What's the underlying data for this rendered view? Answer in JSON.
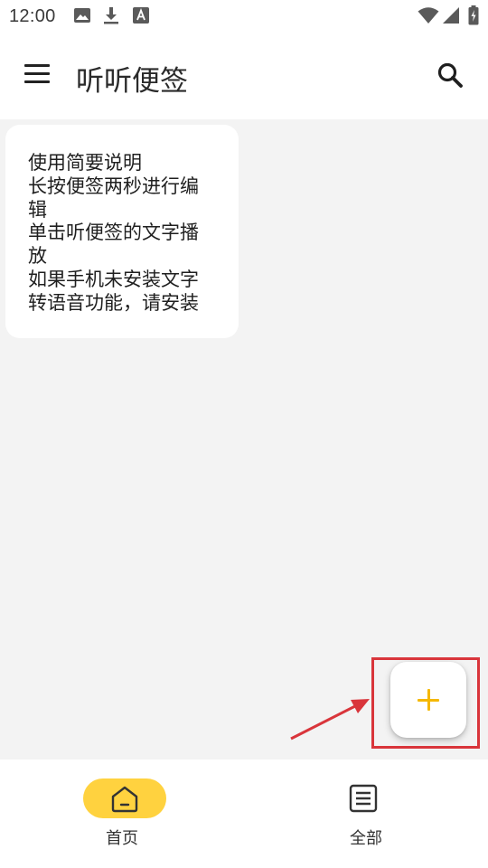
{
  "status_bar": {
    "time": "12:00",
    "left_icons": [
      "image-icon",
      "download-icon",
      "font-icon"
    ],
    "right_icons": [
      "wifi-icon",
      "signal-icon",
      "battery-icon"
    ]
  },
  "app_bar": {
    "title": "听听便签",
    "menu_icon": "menu-icon",
    "search_icon": "search-icon"
  },
  "notes": [
    {
      "text": "使用简要说明\n长按便签两秒进行编辑\n单击听便签的文字播放\n如果手机未安装文字转语音功能，请安装"
    }
  ],
  "fab": {
    "icon": "plus-icon",
    "color": "#f5b800"
  },
  "annotation": {
    "color": "#d9353b"
  },
  "bottom_nav": {
    "items": [
      {
        "label": "首页",
        "icon": "home-icon",
        "active": true
      },
      {
        "label": "全部",
        "icon": "list-icon",
        "active": false
      }
    ],
    "active_color": "#ffd23f"
  }
}
